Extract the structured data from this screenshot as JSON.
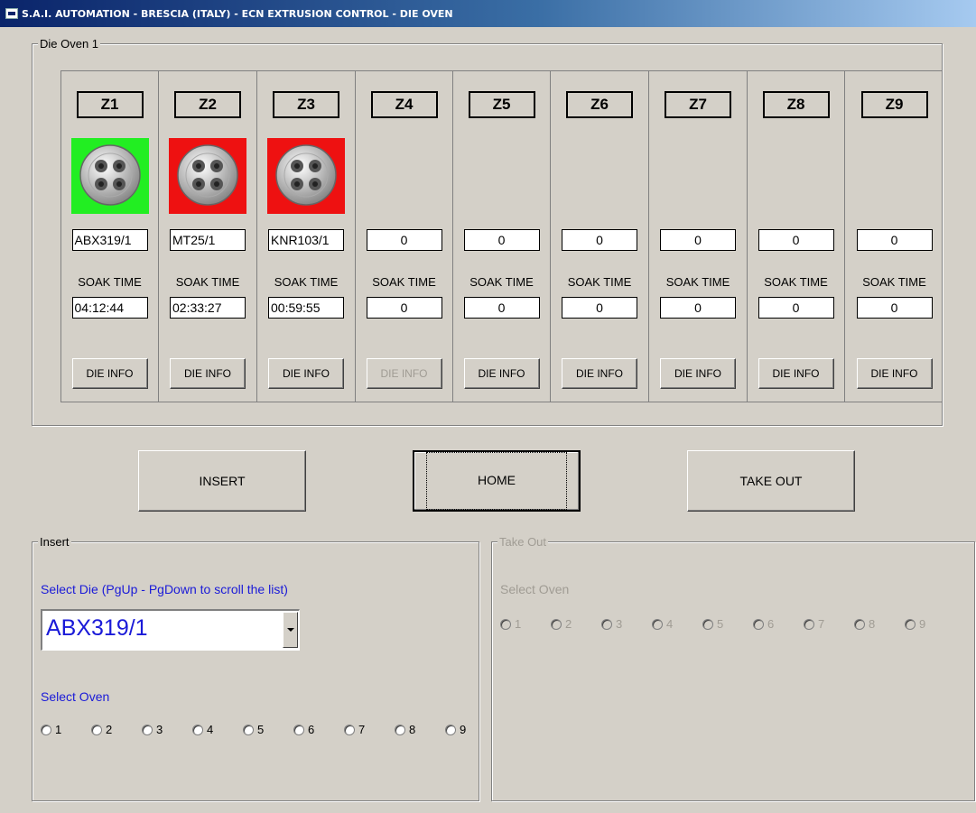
{
  "window": {
    "title": "S.A.I. AUTOMATION - BRESCIA (ITALY) - ECN EXTRUSION CONTROL -  DIE OVEN"
  },
  "oven_group": {
    "label": "Die Oven 1"
  },
  "zones": [
    {
      "label": "Z1",
      "status": "green",
      "has_die": true,
      "die_code": "ABX319/1",
      "soak_label": "SOAK TIME",
      "soak_time": "04:12:44",
      "info_label": "DIE INFO",
      "info_enabled": true
    },
    {
      "label": "Z2",
      "status": "red",
      "has_die": true,
      "die_code": "MT25/1",
      "soak_label": "SOAK TIME",
      "soak_time": "02:33:27",
      "info_label": "DIE INFO",
      "info_enabled": true
    },
    {
      "label": "Z3",
      "status": "red",
      "has_die": true,
      "die_code": "KNR103/1",
      "soak_label": "SOAK TIME",
      "soak_time": "00:59:55",
      "info_label": "DIE INFO",
      "info_enabled": true
    },
    {
      "label": "Z4",
      "status": "empty",
      "has_die": false,
      "die_code": "0",
      "soak_label": "SOAK TIME",
      "soak_time": "0",
      "info_label": "DIE INFO",
      "info_enabled": false
    },
    {
      "label": "Z5",
      "status": "empty",
      "has_die": false,
      "die_code": "0",
      "soak_label": "SOAK TIME",
      "soak_time": "0",
      "info_label": "DIE INFO",
      "info_enabled": true
    },
    {
      "label": "Z6",
      "status": "empty",
      "has_die": false,
      "die_code": "0",
      "soak_label": "SOAK TIME",
      "soak_time": "0",
      "info_label": "DIE INFO",
      "info_enabled": true
    },
    {
      "label": "Z7",
      "status": "empty",
      "has_die": false,
      "die_code": "0",
      "soak_label": "SOAK TIME",
      "soak_time": "0",
      "info_label": "DIE INFO",
      "info_enabled": true
    },
    {
      "label": "Z8",
      "status": "empty",
      "has_die": false,
      "die_code": "0",
      "soak_label": "SOAK TIME",
      "soak_time": "0",
      "info_label": "DIE INFO",
      "info_enabled": true
    },
    {
      "label": "Z9",
      "status": "empty",
      "has_die": false,
      "die_code": "0",
      "soak_label": "SOAK TIME",
      "soak_time": "0",
      "info_label": "DIE INFO",
      "info_enabled": true
    }
  ],
  "buttons": {
    "insert": "INSERT",
    "home": "HOME",
    "take_out": "TAKE OUT"
  },
  "insert_group": {
    "label": "Insert",
    "select_die_label": "Select Die  (PgUp - PgDown to scroll the list)",
    "selected_die": "ABX319/1",
    "select_oven_label": "Select Oven",
    "options": [
      "1",
      "2",
      "3",
      "4",
      "5",
      "6",
      "7",
      "8",
      "9"
    ]
  },
  "takeout_group": {
    "label": "Take Out",
    "select_oven_label": "Select Oven",
    "options": [
      "1",
      "2",
      "3",
      "4",
      "5",
      "6",
      "7",
      "8",
      "9"
    ]
  },
  "colors": {
    "titlebar": "#0a246a",
    "ok": "#22ee22",
    "alarm": "#ee1111",
    "accent_text": "#1a1ad8"
  },
  "icons": {
    "die": "die-disc-icon",
    "app": "app-window-icon"
  }
}
